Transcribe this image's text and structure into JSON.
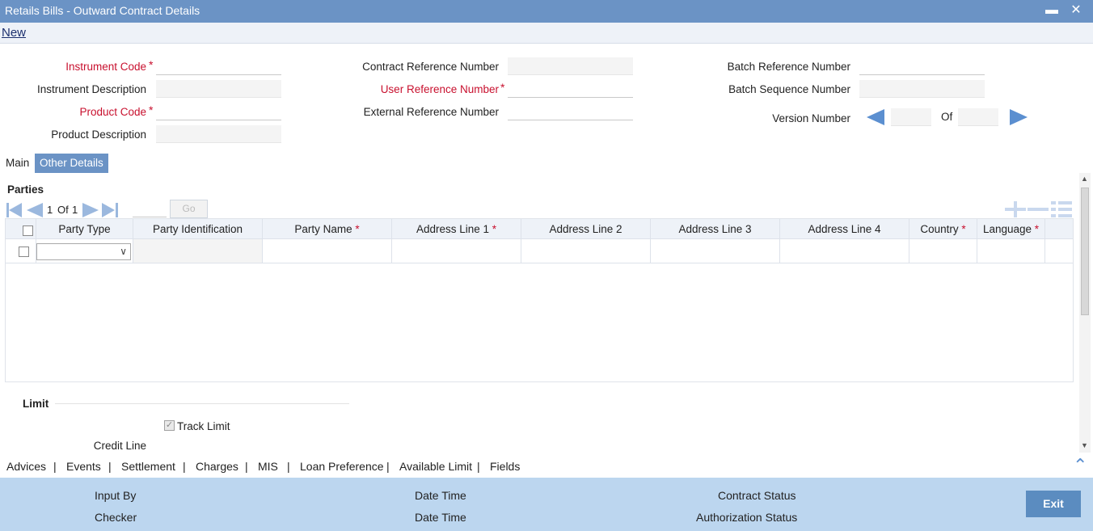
{
  "window": {
    "title": "Retails Bills - Outward Contract Details",
    "minimize_icon": "minimize-icon",
    "close_icon": "close-icon"
  },
  "menu": {
    "new_label": "New"
  },
  "header": {
    "instrument_code": {
      "label": "Instrument Code",
      "required": "*",
      "value": ""
    },
    "instrument_description": {
      "label": "Instrument Description",
      "value": ""
    },
    "product_code": {
      "label": "Product Code",
      "required": "*",
      "value": ""
    },
    "product_description": {
      "label": "Product Description",
      "value": ""
    },
    "contract_reference_number": {
      "label": "Contract Reference Number",
      "value": ""
    },
    "user_reference_number": {
      "label": "User Reference Number",
      "required": "*",
      "value": ""
    },
    "external_reference_number": {
      "label": "External Reference Number",
      "value": ""
    },
    "batch_reference_number": {
      "label": "Batch Reference Number",
      "value": ""
    },
    "batch_sequence_number": {
      "label": "Batch Sequence Number",
      "value": ""
    },
    "version_number": {
      "label": "Version Number",
      "of_label": "Of",
      "current": "",
      "total": ""
    }
  },
  "tabs": [
    {
      "label": "Main",
      "active": false
    },
    {
      "label": "Other Details",
      "active": true
    }
  ],
  "parties": {
    "section_title": "Parties",
    "pager": {
      "current": "1",
      "of_label": "Of",
      "total": "1",
      "goto_value": "",
      "go_label": "Go"
    },
    "columns": [
      {
        "label": "Party Type",
        "required": ""
      },
      {
        "label": "Party Identification",
        "required": ""
      },
      {
        "label": "Party Name",
        "required": "*"
      },
      {
        "label": "Address Line 1",
        "required": "*"
      },
      {
        "label": "Address Line 2",
        "required": ""
      },
      {
        "label": "Address Line 3",
        "required": ""
      },
      {
        "label": "Address Line 4",
        "required": ""
      },
      {
        "label": "Country",
        "required": "*"
      },
      {
        "label": "Language",
        "required": "*"
      }
    ],
    "rows": [
      {
        "party_type": "",
        "party_identification": "",
        "party_name": "",
        "address_line_1": "",
        "address_line_2": "",
        "address_line_3": "",
        "address_line_4": "",
        "country": "",
        "language": ""
      }
    ]
  },
  "limit": {
    "section_title": "Limit",
    "track_limit_label": "Track Limit",
    "track_limit_checked": true,
    "credit_line_label": "Credit Line"
  },
  "bottom_links": [
    "Advices",
    "Events",
    "Settlement",
    "Charges",
    "MIS",
    "Loan Preference",
    "Available Limit",
    "Fields"
  ],
  "footer": {
    "input_by": "Input By",
    "date_time_1": "Date Time",
    "checker": "Checker",
    "date_time_2": "Date Time",
    "contract_status": "Contract Status",
    "authorization_status": "Authorization Status",
    "exit_label": "Exit"
  },
  "colors": {
    "titlebar": "#6b93c5",
    "required": "#c8102e",
    "accent": "#5b8fd0",
    "footer": "#bcd6ef"
  }
}
